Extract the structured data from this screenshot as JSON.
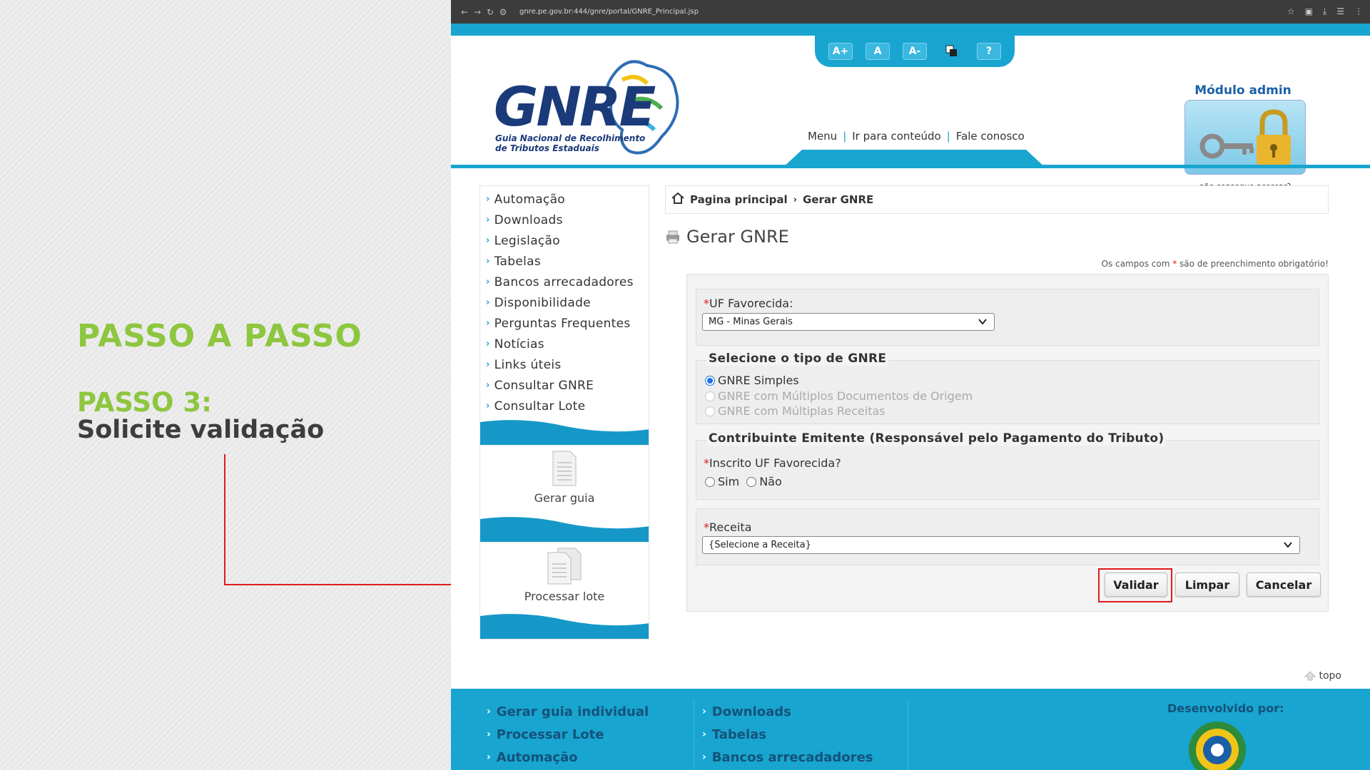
{
  "tutorial": {
    "title": "PASSO A PASSO",
    "step": "PASSO 3:",
    "description": "Solicite validação"
  },
  "browser": {
    "url": "gnre.pe.gov.br:444/gnre/portal/GNRE_Principal.jsp"
  },
  "header": {
    "logo_text": "GNRE",
    "logo_sub_line1": "Guia Nacional de Recolhimento",
    "logo_sub_line2": "de Tributos Estaduais",
    "a11y": [
      "A+",
      "A",
      "A-",
      "?"
    ],
    "links": {
      "menu": "Menu",
      "content": "Ir para conteúdo",
      "contact": "Fale conosco"
    },
    "admin_title": "Módulo admin",
    "admin_help": "não consegue acessar?"
  },
  "sidebar": {
    "items": [
      {
        "label": "Automação"
      },
      {
        "label": "Downloads"
      },
      {
        "label": "Legislação"
      },
      {
        "label": "Tabelas"
      },
      {
        "label": "Bancos arrecadadores"
      },
      {
        "label": "Disponibilidade"
      },
      {
        "label": "Perguntas Frequentes"
      },
      {
        "label": "Notícias"
      },
      {
        "label": "Links úteis"
      },
      {
        "label": "Consultar GNRE"
      },
      {
        "label": "Consultar Lote"
      }
    ],
    "gerar_guia": "Gerar guia",
    "processar_lote": "Processar lote"
  },
  "breadcrumb": {
    "home": "Pagina principal",
    "current": "Gerar GNRE"
  },
  "page": {
    "title": "Gerar GNRE",
    "required_note_prefix": "Os campos com ",
    "required_note_star": "*",
    "required_note_suffix": " são de preenchimento obrigatório!"
  },
  "form": {
    "uf_label": "UF Favorecida:",
    "uf_value": "MG - Minas Gerais",
    "tipo_legend": "Selecione o tipo de GNRE",
    "tipo_options": [
      {
        "label": "GNRE Simples",
        "checked": true,
        "disabled": false
      },
      {
        "label": "GNRE com Múltiplos Documentos de Origem",
        "checked": false,
        "disabled": true
      },
      {
        "label": "GNRE com Múltiplas Receitas",
        "checked": false,
        "disabled": true
      }
    ],
    "contrib_legend": "Contribuinte Emitente (Responsável pelo Pagamento do Tributo)",
    "inscrito_label": "Inscrito UF Favorecida?",
    "sim": "Sim",
    "nao": "Não",
    "receita_label": "Receita",
    "receita_value": "{Selecione a Receita}"
  },
  "buttons": {
    "validar": "Validar",
    "limpar": "Limpar",
    "cancelar": "Cancelar"
  },
  "topo": "topo",
  "footer": {
    "col1": [
      "Gerar guia individual",
      "Processar Lote",
      "Automação"
    ],
    "col2": [
      "Downloads",
      "Tabelas",
      "Bancos arrecadadores"
    ],
    "developed_by": "Desenvolvido por:"
  },
  "colors": {
    "accent": "#18a5d0",
    "highlight": "#e01b1b",
    "step_green": "#8dc63f"
  }
}
